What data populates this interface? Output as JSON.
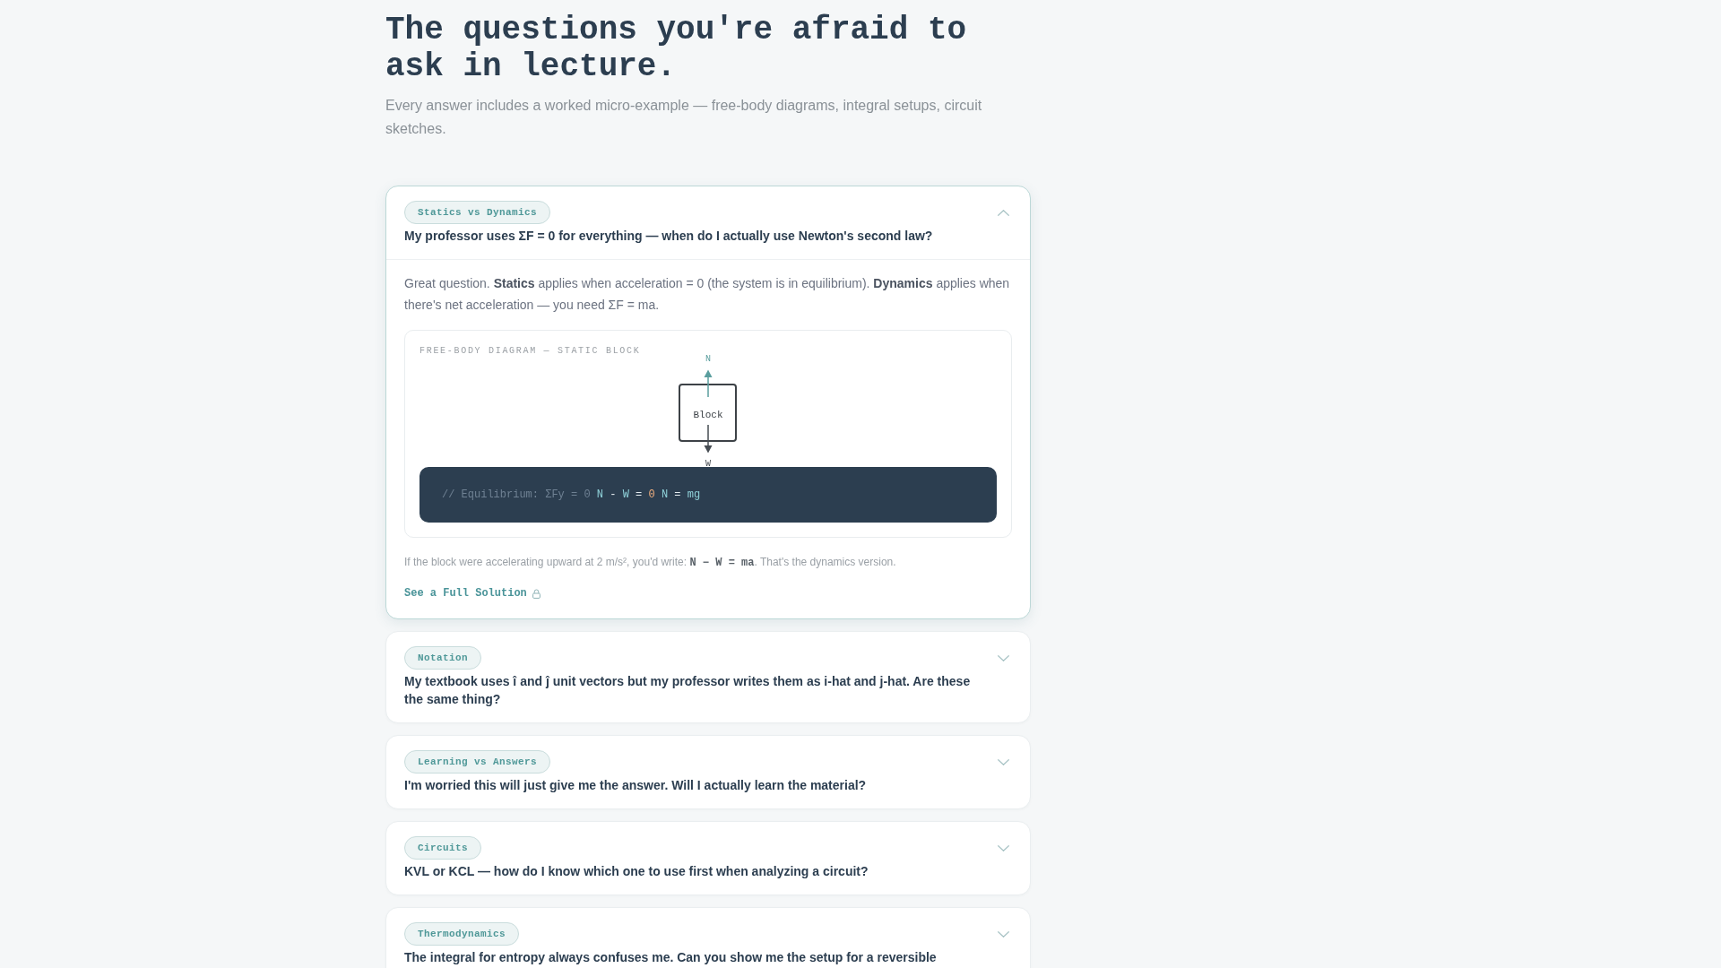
{
  "heading": {
    "title": "The questions you're afraid to ask in lecture.",
    "subtitle": "Every answer includes a worked micro-example — free-body diagrams, integral setups, circuit sketches."
  },
  "faq": [
    {
      "tag": "Statics vs Dynamics",
      "question": "My professor uses ΣF = 0 for everything — when do I actually use Newton's second law?",
      "expanded": true,
      "answer": {
        "text": "Great question. **Statics** applies when acceleration = 0 (the system is in equilibrium). **Dynamics** applies when there's net acceleration — you need ΣF = ma.",
        "diagram": {
          "caption": "FREE-BODY DIAGRAM — STATIC BLOCK",
          "body": "Block",
          "forces": [
            {
              "label": "N",
              "kind": "up",
              "color": "#5a9e9e"
            },
            {
              "label": "W",
              "kind": "down",
              "color": "#464c52"
            }
          ],
          "code": [
            {
              "kind": "comment",
              "text": "// Equilibrium: ΣFy = 0"
            },
            {
              "kind": "var",
              "text": "N"
            },
            {
              "kind": "op",
              "text": "-"
            },
            {
              "kind": "var",
              "text": "W"
            },
            {
              "kind": "op",
              "text": "="
            },
            {
              "kind": "num",
              "text": "0"
            },
            {
              "kind": "var",
              "text": "N"
            },
            {
              "kind": "op",
              "text": "="
            },
            {
              "kind": "var",
              "text": "mg"
            }
          ]
        },
        "note": [
          {
            "kind": "text",
            "text": "If the block were accelerating upward at 2 m/s², you'd write: "
          },
          {
            "kind": "code",
            "text": "N − W = ma"
          },
          {
            "kind": "text",
            "text": ". That's the dynamics version."
          }
        ],
        "link": {
          "label": "See a Full Solution",
          "locked": true
        }
      }
    },
    {
      "tag": "Notation",
      "question": "My textbook uses î and ĵ unit vectors but my professor writes them as i-hat and j-hat. Are these the same thing?",
      "expanded": false
    },
    {
      "tag": "Learning vs Answers",
      "question": "I'm worried this will just give me the answer. Will I actually learn the material?",
      "expanded": false
    },
    {
      "tag": "Circuits",
      "question": "KVL or KCL — how do I know which one to use first when analyzing a circuit?",
      "expanded": false
    },
    {
      "tag": "Thermodynamics",
      "question": "The integral for entropy always confuses me. Can you show me the setup for a reversible",
      "expanded": false
    }
  ]
}
